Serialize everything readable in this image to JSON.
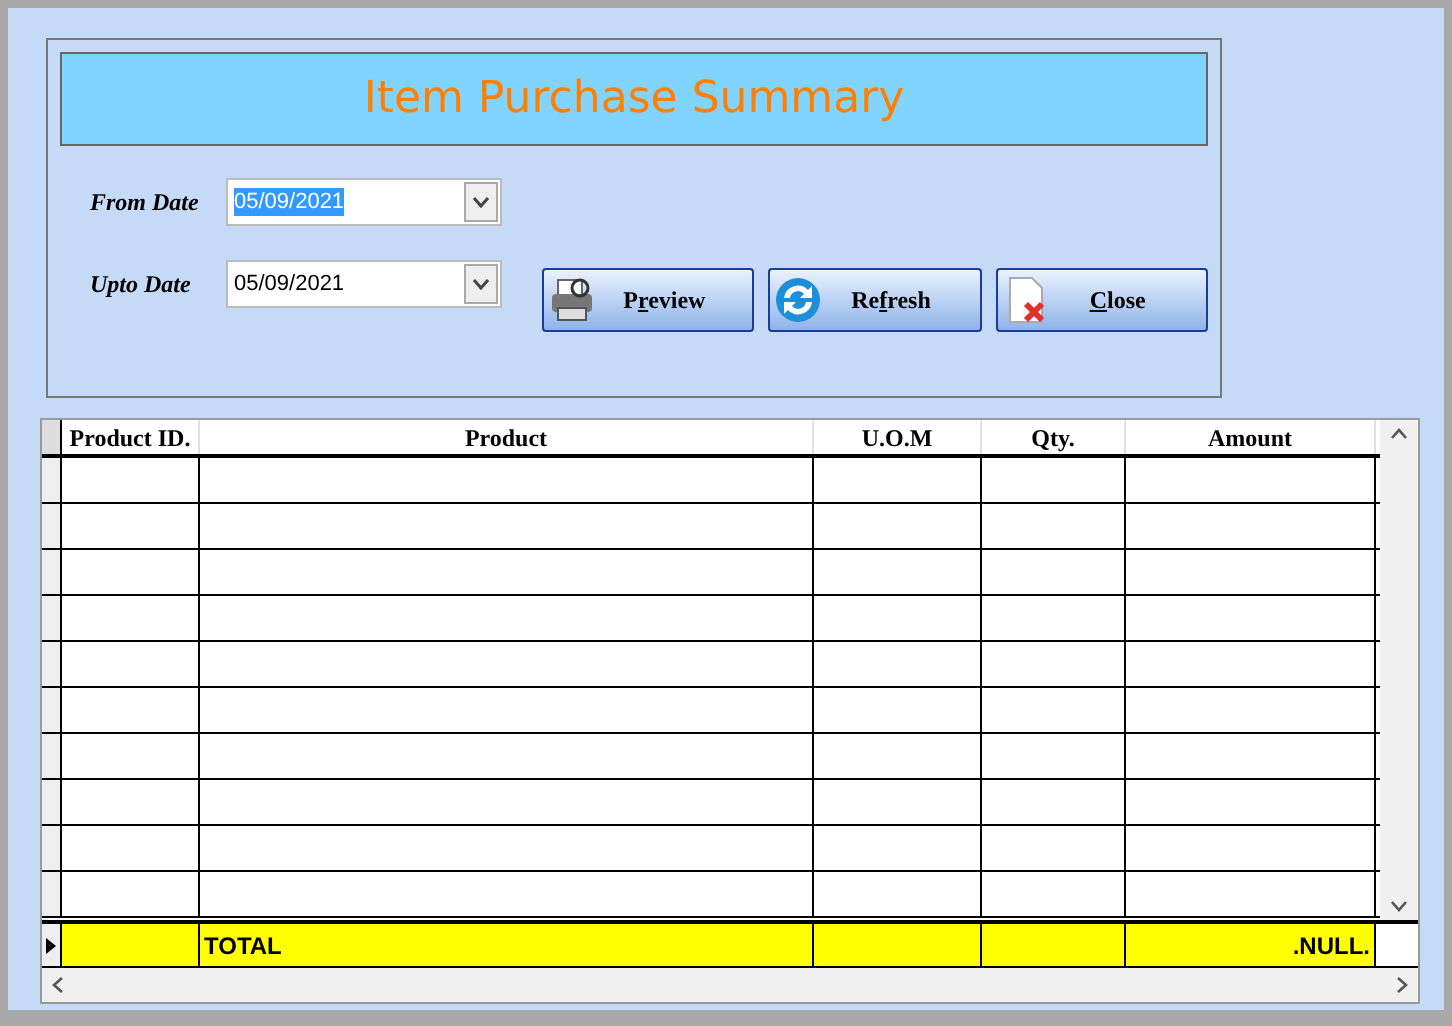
{
  "title": "Item Purchase Summary",
  "date_fields": [
    {
      "label": "From Date",
      "value": "05/09/2021",
      "selected": true
    },
    {
      "label": "Upto Date",
      "value": "05/09/2021",
      "selected": false
    }
  ],
  "buttons": [
    {
      "kind": "preview",
      "before": "P",
      "access_key": "r",
      "after": "eview"
    },
    {
      "kind": "refresh",
      "before": "Re",
      "access_key": "f",
      "after": "resh"
    },
    {
      "kind": "close",
      "access_key": "C",
      "after": "lose"
    }
  ],
  "table": {
    "columns": [
      "Product ID.",
      "Product",
      "U.O.M",
      "Qty.",
      "Amount"
    ],
    "total_row": {
      "label": "TOTAL",
      "amount": ".NULL.",
      "current": true
    }
  }
}
